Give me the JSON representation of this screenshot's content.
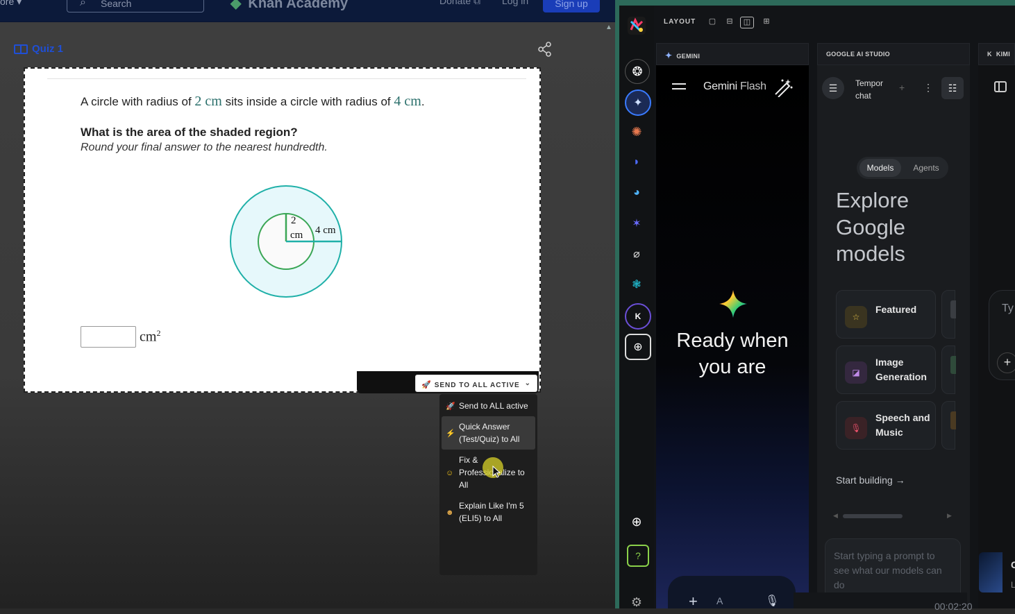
{
  "ka": {
    "more": "ore ▾",
    "search_placeholder": "Search",
    "logo": "Khan Academy",
    "donate": "Donate ⧉",
    "login": "Log in",
    "signup": "Sign up",
    "quiz_title": "Quiz 1"
  },
  "question": {
    "line1_a": "A circle with radius of ",
    "r1": "2 cm",
    "line1_b": " sits inside a circle with radius of ",
    "r2": "4 cm",
    "line1_c": ".",
    "prompt": "What is the area of the shaded region?",
    "instruction": "Round your final answer to the nearest hundredth.",
    "fig_inner_label_1": "2",
    "fig_inner_label_2": "cm",
    "fig_outer_label": "4 cm",
    "answer_value": "",
    "unit": "cm",
    "unit_exp": "2"
  },
  "send": {
    "button_label": "SEND TO ALL ACTIVE",
    "menu": [
      {
        "label": "Send to ALL active",
        "icon": "rocket-icon"
      },
      {
        "label": "Quick Answer (Test/Quiz) to All",
        "icon": "lightning-icon"
      },
      {
        "label": "Fix & Professionalize to All",
        "icon": "smile-icon"
      },
      {
        "label": "Explain Like I'm 5 (ELI5) to All",
        "icon": "baby-icon"
      }
    ]
  },
  "panel": {
    "layout_label": "LAYOUT",
    "columns": [
      "GEMINI",
      "GOOGLE AI STUDIO",
      "KIMI"
    ],
    "rail_icons": [
      "app-logo-icon",
      "chatgpt-icon",
      "gemini-icon",
      "claude-icon",
      "deepseek-icon",
      "copilot-icon",
      "perplexity-icon",
      "grok-icon",
      "qwen-icon",
      "kimi-icon",
      "add-panel-icon",
      "crosshair-icon",
      "help-icon",
      "settings-icon"
    ],
    "accent": "#2d6a5a"
  },
  "gemini": {
    "title_a": "Gemini",
    "title_b": "Flash",
    "ready": "Ready when you are",
    "input_hint": "A"
  },
  "studio": {
    "chat_title": "Tempor chat",
    "tab_models": "Models",
    "tab_agents": "Agents",
    "explore": "Explore Google models",
    "cards": [
      {
        "label": "Featured",
        "icon": "star-icon"
      },
      {
        "label": "Image Generation",
        "icon": "image-icon"
      },
      {
        "label": "Speech and Music",
        "icon": "mic-icon"
      }
    ],
    "start_building": "Start building →",
    "prompt_placeholder": "Start typing a prompt to see what our models can do",
    "time": "00:02:20"
  },
  "kimi": {
    "type_hint": "Ty",
    "card_c": "C",
    "card_l": "L"
  }
}
